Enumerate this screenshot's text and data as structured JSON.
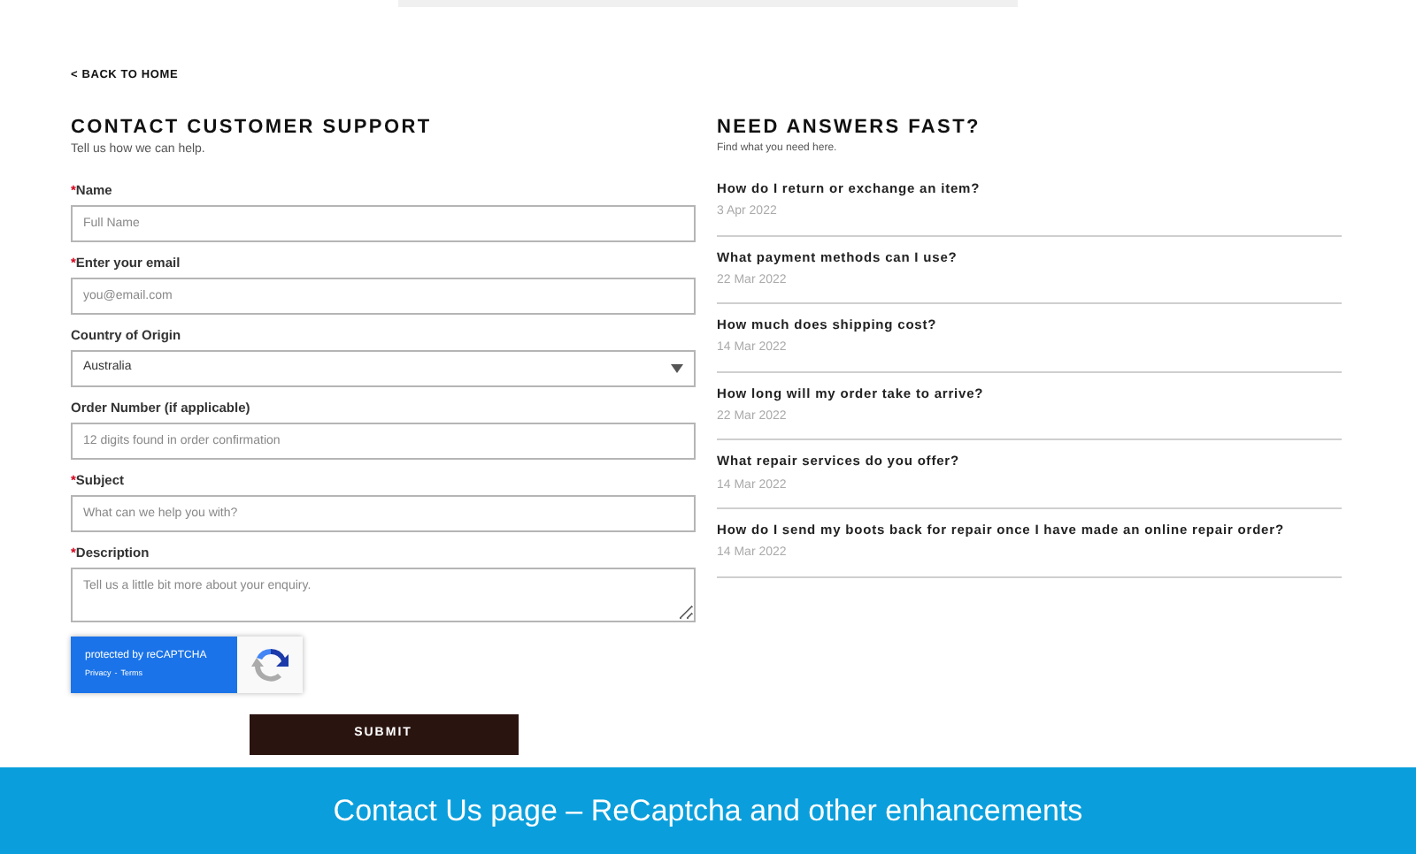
{
  "back_link": "< BACK TO HOME",
  "contact": {
    "title": "CONTACT CUSTOMER SUPPORT",
    "subtitle": "Tell us how we can help.",
    "required_mark": "*",
    "fields": [
      {
        "kind": "text",
        "label": "Name",
        "required": true,
        "placeholder": "Full Name"
      },
      {
        "kind": "text",
        "label": "Enter your email",
        "required": true,
        "placeholder": "you@email.com"
      },
      {
        "kind": "select",
        "label": "Country of Origin",
        "required": false,
        "value": "Australia"
      },
      {
        "kind": "text",
        "label": "Order Number (if applicable)",
        "required": false,
        "placeholder": "12 digits found in order confirmation"
      },
      {
        "kind": "text",
        "label": "Subject",
        "required": true,
        "placeholder": "What can we help you with?"
      },
      {
        "kind": "textarea",
        "label": "Description",
        "required": true,
        "placeholder": "Tell us a little bit more about your enquiry."
      }
    ],
    "captcha": {
      "title": "protected by reCAPTCHA",
      "links": [
        "Privacy",
        "Terms"
      ],
      "separator": "-"
    },
    "submit": "SUBMIT"
  },
  "faq": {
    "title": "NEED ANSWERS FAST?",
    "subtitle": "Find what you need here.",
    "items": [
      {
        "question": "How do I return or exchange an item?",
        "date": "3 Apr 2022"
      },
      {
        "question": "What payment methods can I use?",
        "date": "22 Mar 2022"
      },
      {
        "question": "How much does shipping cost?",
        "date": "14 Mar 2022"
      },
      {
        "question": "How long will my order take to arrive?",
        "date": "22 Mar 2022"
      },
      {
        "question": "What repair services do you offer?",
        "date": "14 Mar 2022"
      },
      {
        "question": "How do I send my boots back for repair once I have made an online repair order?",
        "date": "14 Mar 2022"
      }
    ]
  },
  "banner": "Contact Us page – ReCaptcha and other enhancements"
}
